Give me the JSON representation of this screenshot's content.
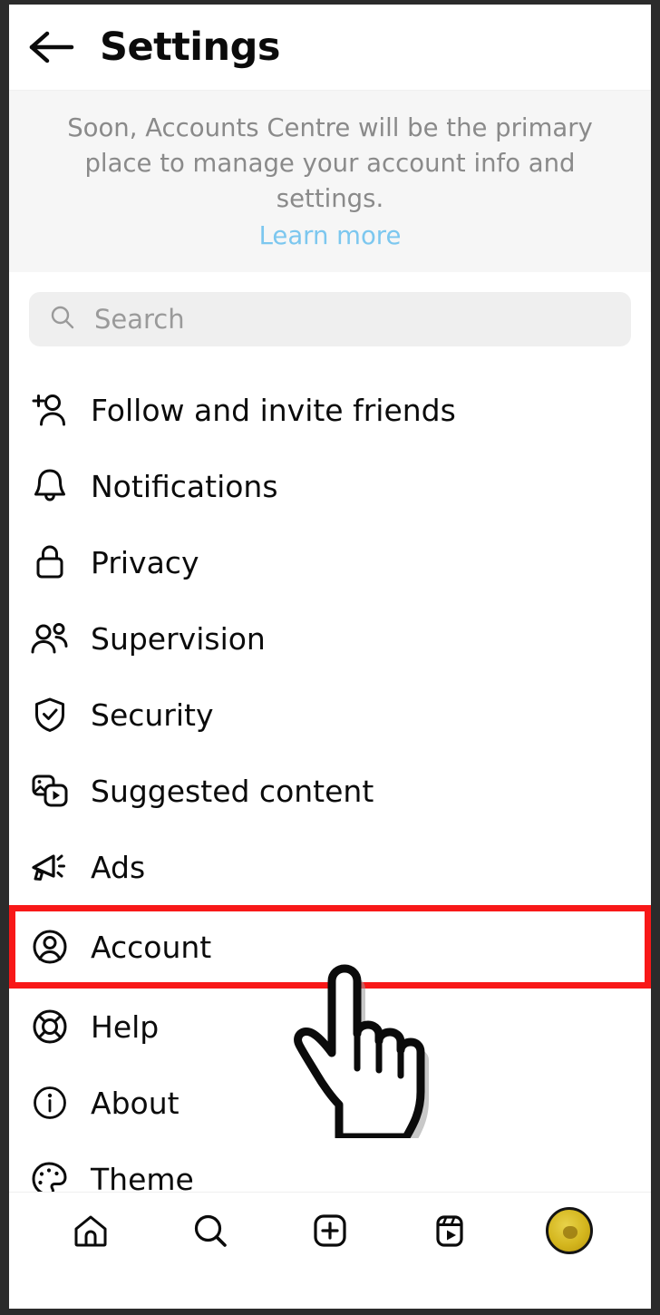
{
  "header": {
    "back_icon": "arrow-left-icon",
    "title": "Settings"
  },
  "banner": {
    "text": "Soon, Accounts Centre will be the primary place to manage your account info and settings.",
    "link_label": "Learn more",
    "link_color": "#7cc7ef"
  },
  "search": {
    "icon": "search-icon",
    "placeholder": "Search",
    "value": ""
  },
  "menu": {
    "items": [
      {
        "label": "Follow and invite friends",
        "icon": "person-add-icon",
        "highlighted": false
      },
      {
        "label": "Notifications",
        "icon": "bell-icon",
        "highlighted": false
      },
      {
        "label": "Privacy",
        "icon": "lock-icon",
        "highlighted": false
      },
      {
        "label": "Supervision",
        "icon": "people-icon",
        "highlighted": false
      },
      {
        "label": "Security",
        "icon": "shield-check-icon",
        "highlighted": false
      },
      {
        "label": "Suggested content",
        "icon": "media-stack-icon",
        "highlighted": false
      },
      {
        "label": "Ads",
        "icon": "megaphone-icon",
        "highlighted": false
      },
      {
        "label": "Account",
        "icon": "user-circle-icon",
        "highlighted": true
      },
      {
        "label": "Help",
        "icon": "lifebuoy-icon",
        "highlighted": false
      },
      {
        "label": "About",
        "icon": "info-circle-icon",
        "highlighted": false
      },
      {
        "label": "Theme",
        "icon": "palette-icon",
        "highlighted": false
      }
    ]
  },
  "highlight": {
    "target_label": "Account",
    "border_color": "#f81818",
    "cursor": "pointing-hand-cursor"
  },
  "bottom_nav": {
    "items": [
      {
        "name": "home",
        "icon": "home-icon"
      },
      {
        "name": "search",
        "icon": "search-icon"
      },
      {
        "name": "create",
        "icon": "plus-square-icon"
      },
      {
        "name": "reels",
        "icon": "reels-icon"
      },
      {
        "name": "profile",
        "icon": "avatar-icon"
      }
    ]
  }
}
